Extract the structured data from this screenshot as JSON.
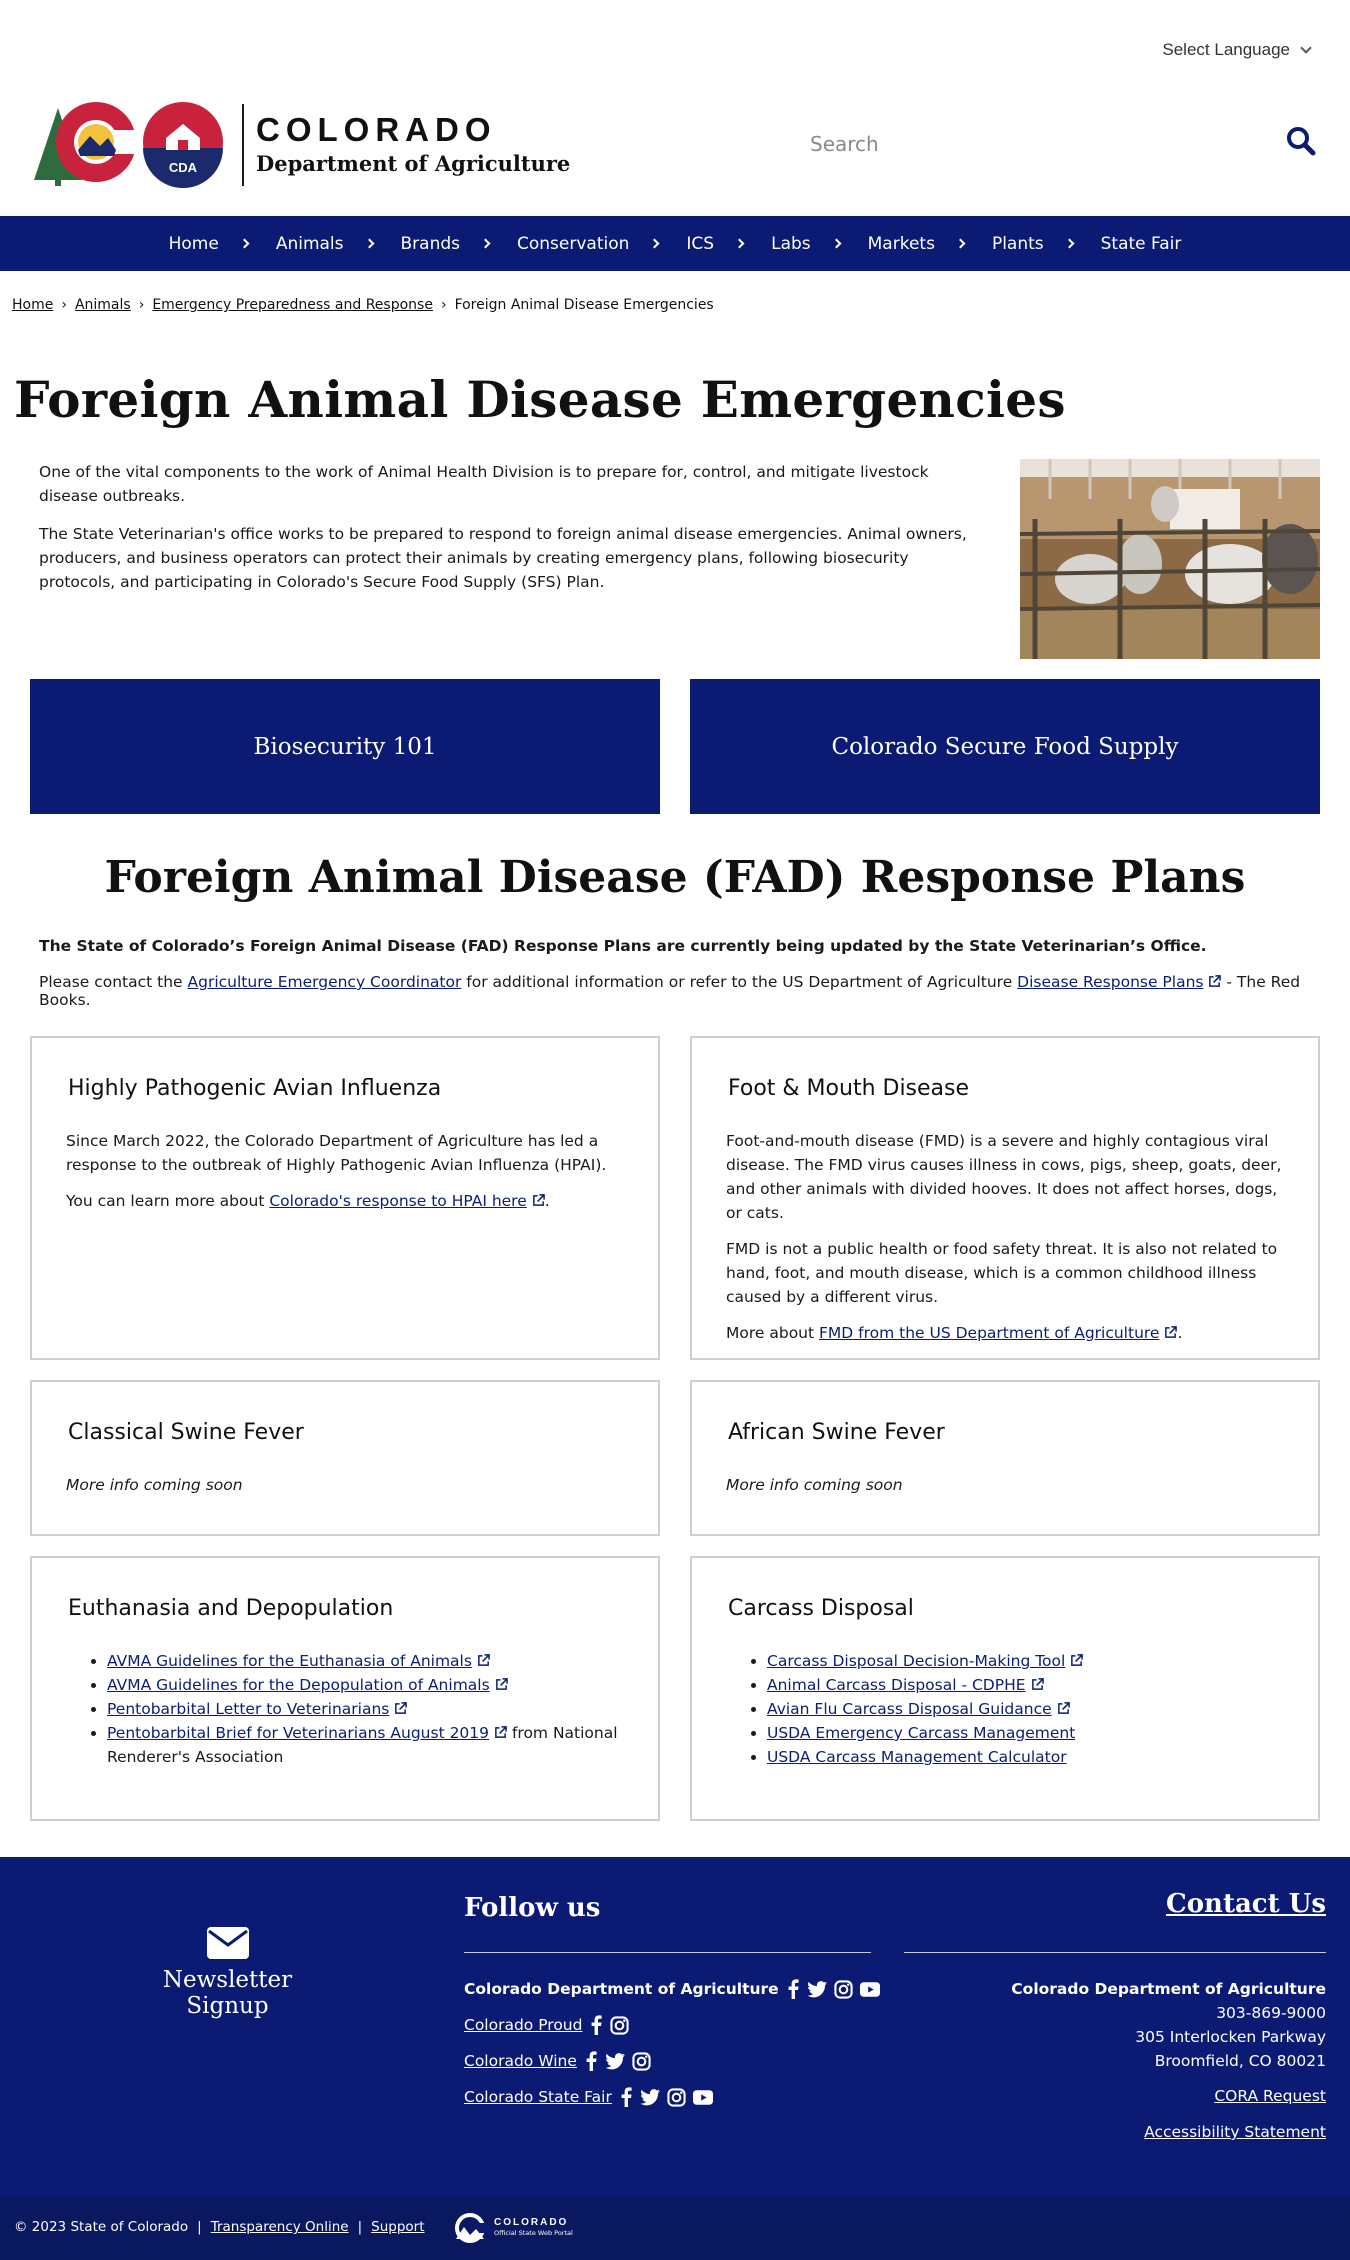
{
  "header": {
    "language_label": "Select Language",
    "logo_name": "COLORADO",
    "logo_dept": "Department of Agriculture",
    "logo_badge": "CDA",
    "search_placeholder": "Search"
  },
  "nav": [
    "Home",
    "Animals",
    "Brands",
    "Conservation",
    "ICS",
    "Labs",
    "Markets",
    "Plants",
    "State Fair"
  ],
  "breadcrumb": {
    "items": [
      "Home",
      "Animals",
      "Emergency Preparedness and Response"
    ],
    "current": "Foreign Animal Disease Emergencies"
  },
  "page_title": "Foreign Animal Disease Emergencies",
  "intro": {
    "p1": "One of the vital components to the work of Animal Health Division is to prepare for, control, and mitigate livestock disease outbreaks.",
    "p2": "The State Veterinarian's office works to be prepared to respond to foreign animal disease emergencies. Animal owners, producers, and business operators can protect their animals by creating emergency plans, following biosecurity protocols, and participating in Colorado's Secure Food Supply (SFS) Plan."
  },
  "cta": {
    "left": "Biosecurity 101",
    "right": "Colorado Secure Food Supply"
  },
  "fad": {
    "title": "Foreign Animal Disease (FAD) Response Plans",
    "note": "The State of Colorado’s Foreign Animal Disease (FAD) Response Plans are currently being updated by the State Veterinarian’s Office.",
    "contact_prefix": "Please contact the ",
    "contact_link": "Agriculture Emergency Coordinator",
    "contact_mid": " for additional information or refer to the US Department of Agriculture ",
    "plans_link": "Disease Response Plans",
    "contact_suffix": " - The Red Books."
  },
  "cards": {
    "hpai": {
      "title": "Highly Pathogenic Avian Influenza",
      "p1": "Since March 2022, the Colorado Department of Agriculture has led a response to the outbreak of Highly Pathogenic Avian Influenza (HPAI).",
      "p2_prefix": "You can learn more about ",
      "p2_link": "Colorado's response to HPAI here",
      "p2_suffix": "."
    },
    "fmd": {
      "title": "Foot & Mouth Disease",
      "p1": "Foot-and-mouth disease (FMD) is a severe and highly contagious viral disease. The FMD virus causes illness in cows, pigs, sheep, goats, deer, and other animals with divided hooves. It does not affect horses, dogs, or cats.",
      "p2": "FMD is not a public health or food safety threat. It is also not related to hand, foot, and mouth disease, which is a common childhood illness caused by a different virus.",
      "p3_prefix": "More about ",
      "p3_link": "FMD from the US Department of Agriculture",
      "p3_suffix": "."
    },
    "csf": {
      "title": "Classical Swine Fever",
      "note": "More info coming soon"
    },
    "asf": {
      "title": "African Swine Fever",
      "note": "More info coming soon"
    },
    "euth": {
      "title": "Euthanasia and Depopulation",
      "links": [
        "AVMA Guidelines for the Euthanasia of Animals",
        "AVMA Guidelines for the Depopulation of Animals",
        "Pentobarbital Letter to Veterinarians",
        "Pentobarbital Brief for Veterinarians August 2019"
      ],
      "last_suffix": " from National Renderer's Association"
    },
    "carcass": {
      "title": "Carcass Disposal",
      "links": [
        "Carcass Disposal Decision-Making Tool",
        "Animal Carcass Disposal - CDPHE",
        "Avian Flu Carcass Disposal Guidance",
        "USDA Emergency Carcass Management",
        "USDA Carcass Management Calculator"
      ]
    }
  },
  "footer": {
    "newsletter": "Newsletter Signup",
    "follow_title": "Follow us",
    "social": [
      {
        "name": "Colorado Department of Agriculture",
        "icons": [
          "facebook-icon",
          "twitter-icon",
          "instagram-icon",
          "youtube-icon"
        ]
      },
      {
        "name": "Colorado Proud",
        "icons": [
          "facebook-icon",
          "instagram-icon"
        ]
      },
      {
        "name": "Colorado Wine",
        "icons": [
          "facebook-icon",
          "twitter-icon",
          "instagram-icon"
        ]
      },
      {
        "name": "Colorado State Fair",
        "icons": [
          "facebook-icon",
          "twitter-icon",
          "instagram-icon",
          "youtube-icon"
        ]
      }
    ],
    "contact_title": "Contact Us",
    "contact_org": "Colorado Department of Agriculture",
    "phone": "303-869-9000",
    "address1": "305 Interlocken Parkway",
    "address2": "Broomfield, CO 80021",
    "cora": "CORA Request",
    "accessibility": "Accessibility Statement",
    "copyright": "© 2023 State of Colorado",
    "transparency": "Transparency Online",
    "support": "Support",
    "portal_name": "COLORADO",
    "portal_sub": "Official State Web Portal"
  },
  "colors": {
    "brand_navy": "#0b1a72",
    "link": "#0b1e73",
    "card_border": "#cfcfcf"
  }
}
